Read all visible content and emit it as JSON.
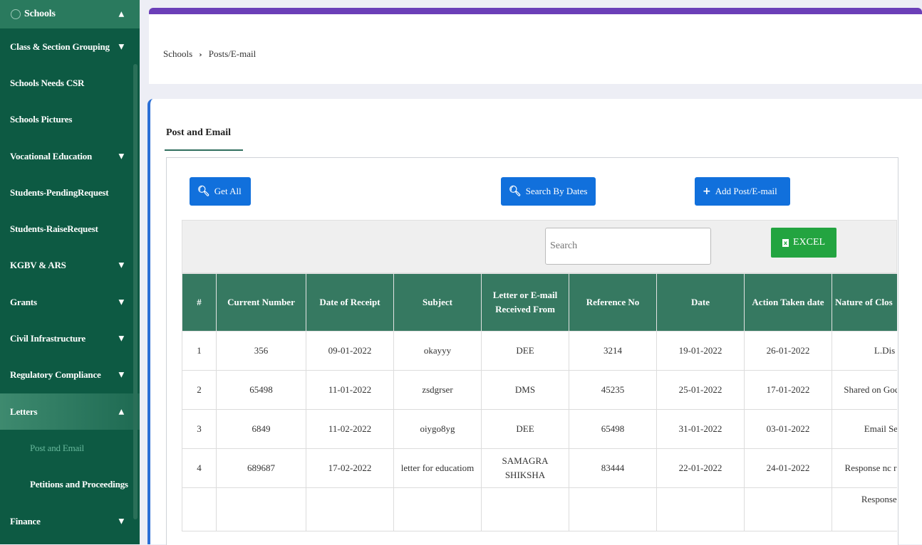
{
  "sidebar": {
    "items": [
      {
        "label": "Schools",
        "chevron": "▲"
      },
      {
        "label": "Class & Section Grouping",
        "chevron": "▼"
      },
      {
        "label": "Schools Needs CSR",
        "chevron": ""
      },
      {
        "label": "Schools Pictures",
        "chevron": ""
      },
      {
        "label": "Vocational Education",
        "chevron": "▼"
      },
      {
        "label": "Students-PendingRequest",
        "chevron": ""
      },
      {
        "label": "Students-RaiseRequest",
        "chevron": ""
      },
      {
        "label": "KGBV & ARS",
        "chevron": "▼"
      },
      {
        "label": "Grants",
        "chevron": "▼"
      },
      {
        "label": "Civil Infrastructure",
        "chevron": "▼"
      },
      {
        "label": "Regulatory Compliance",
        "chevron": "▼"
      },
      {
        "label": "Letters",
        "chevron": "▲"
      },
      {
        "label": "Post and Email",
        "chevron": ""
      },
      {
        "label": "Petitions and Proceedings",
        "chevron": ""
      },
      {
        "label": "Finance",
        "chevron": "▼"
      }
    ]
  },
  "breadcrumb": {
    "root": "Schools",
    "separator": "›",
    "current": "Posts/E-mail"
  },
  "tab": {
    "label": "Post and Email"
  },
  "buttons": {
    "get_all": "Get All",
    "search_by_dates": "Search By Dates",
    "add_post": "Add Post/E-mail",
    "excel": "EXCEL",
    "search_glyph": "🔍︎",
    "plus_glyph": "+"
  },
  "search": {
    "placeholder": "Search"
  },
  "table": {
    "columns": [
      "#",
      "Current Number",
      "Date of Receipt",
      "Subject",
      "Letter or E-mail Received From",
      "Reference No",
      "Date",
      "Action Taken date",
      "Nature of Clos"
    ],
    "rows": [
      [
        "1",
        "356",
        "09-01-2022",
        "okayyy",
        "DEE",
        "3214",
        "19-01-2022",
        "26-01-2022",
        "L.Dis"
      ],
      [
        "2",
        "65498",
        "11-01-2022",
        "zsdgrser",
        "DMS",
        "45235",
        "25-01-2022",
        "17-01-2022",
        "Shared on Goc Sheets"
      ],
      [
        "3",
        "6849",
        "11-02-2022",
        "oiygo8yg",
        "DEE",
        "65498",
        "31-01-2022",
        "03-01-2022",
        "Email Sent"
      ],
      [
        "4",
        "689687",
        "17-02-2022",
        "letter for educatiom",
        "SAMAGRA SHIKSHA",
        "83444",
        "22-01-2022",
        "24-01-2022",
        "Response nc required"
      ],
      [
        "",
        "",
        "",
        "",
        "",
        "",
        "",
        "",
        "Response nc"
      ]
    ]
  },
  "colors": {
    "sidebar_bg": "#0d5a43",
    "header_accent": "#6b3fb8",
    "primary_button": "#1170dc",
    "excel_button": "#23a440",
    "table_header": "#367961",
    "main_card_accent": "#2b6fd6"
  }
}
